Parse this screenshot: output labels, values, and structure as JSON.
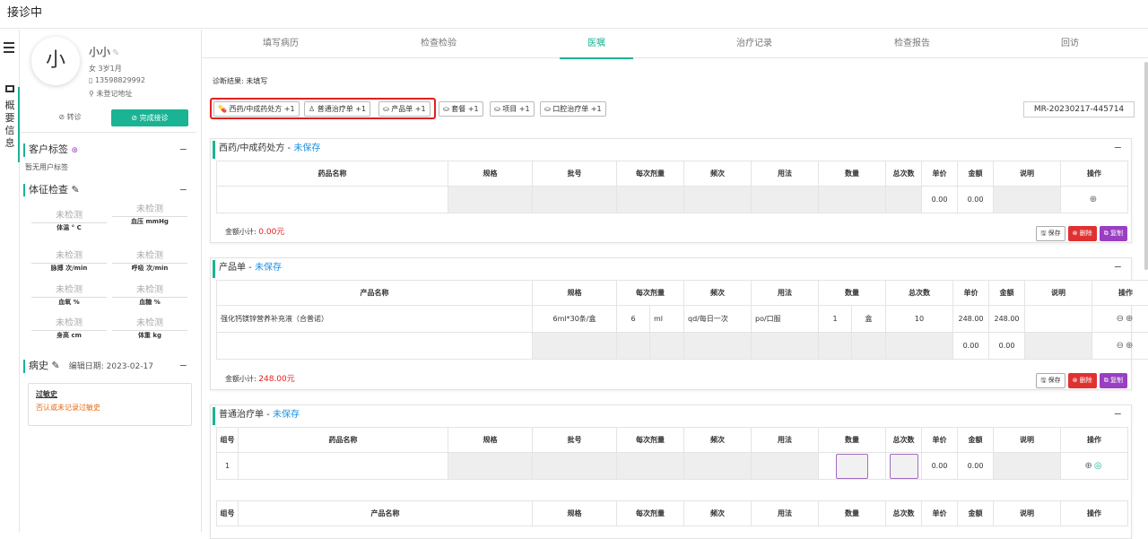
{
  "page": {
    "title": "接诊中"
  },
  "rail": {
    "info_label": [
      "概",
      "要",
      "信",
      "息"
    ]
  },
  "patient": {
    "avatar_char": "小",
    "name": "小小",
    "meta": "女  3岁1月",
    "phone": "13598829992",
    "address": "未登记地址",
    "transfer_label": "⊘ 转诊",
    "finish_label": "⊘ 完成接诊"
  },
  "tags": {
    "title": "客户标签",
    "empty": "暂无用户标签"
  },
  "vitals": {
    "title": "体征检查",
    "items": [
      {
        "value": "未检测",
        "label": "体温 ° C"
      },
      {
        "value": "未检测",
        "label": "血压 mmHg"
      },
      {
        "value": "未检测",
        "label": "脉搏 次/min"
      },
      {
        "value": "未检测",
        "label": "呼吸 次/min"
      },
      {
        "value": "未检测",
        "label": "血氧 %"
      },
      {
        "value": "未检测",
        "label": "血糖 %"
      },
      {
        "value": "未检测",
        "label": "身高 cm"
      },
      {
        "value": "未检测",
        "label": "体重 kg"
      }
    ]
  },
  "history": {
    "title": "病史",
    "edit_date": "编辑日期:  2023-02-17",
    "allergy_title": "过敏史",
    "allergy_text": "否认或未记录过敏史"
  },
  "tabs": [
    "填写病历",
    "检查检验",
    "医嘱",
    "治疗记录",
    "检查报告",
    "回访"
  ],
  "active_tab": 2,
  "diagnosis": "诊断结果:  未填写",
  "pills": [
    "💊 西药/中成药处方 +1",
    "♙ 普通治疗单 +1",
    "⛀ 产品单 +1",
    "⛀ 套餐 +1",
    "⛀ 项目 +1",
    "⛀ 口腔治疗单 +1"
  ],
  "record_no": "MR-20230217-445714",
  "cards": {
    "western": {
      "title": "西药/中成药处方 - ",
      "status": "未保存",
      "headers": [
        "药品名称",
        "规格",
        "批号",
        "每次剂量",
        "频次",
        "用法",
        "数量",
        "总次数",
        "单价",
        "金额",
        "说明",
        "操作"
      ],
      "row": {
        "price": "0.00",
        "amount": "0.00"
      },
      "subtotal_label": "金额小计:",
      "subtotal_value": "0.00元"
    },
    "product": {
      "title": "产品单 - ",
      "status": "未保存",
      "headers": [
        "产品名称",
        "规格",
        "每次剂量",
        "频次",
        "用法",
        "数量",
        "总次数",
        "单价",
        "金额",
        "说明",
        "操作"
      ],
      "row1": {
        "name": "强化钙镁锌营养补充液（合普诺）",
        "spec": "6ml*30条/盒",
        "dose": "6",
        "dose_unit": "ml",
        "freq": "qd/每日一次",
        "usage": "po/口服",
        "qty": "1",
        "qty_unit": "盒",
        "times": "10",
        "price": "248.00",
        "amount": "248.00"
      },
      "row2": {
        "price": "0.00",
        "amount": "0.00"
      },
      "subtotal_label": "金额小计:",
      "subtotal_value": "248.00元"
    },
    "treatment": {
      "title": "普通治疗单 - ",
      "status": "未保存",
      "headers": [
        "组号",
        "药品名称",
        "规格",
        "批号",
        "每次剂量",
        "频次",
        "用法",
        "数量",
        "总次数",
        "单价",
        "金额",
        "说明",
        "操作"
      ],
      "row": {
        "group": "1",
        "price": "0.00",
        "amount": "0.00"
      },
      "headers2": [
        "组号",
        "产品名称",
        "规格",
        "每次剂量",
        "频次",
        "用法",
        "数量",
        "总次数",
        "单价",
        "金额",
        "说明",
        "操作"
      ]
    }
  },
  "buttons": {
    "save": "🖫 保存",
    "delete": "⊗ 删除",
    "copy": "⧉ 复制"
  }
}
